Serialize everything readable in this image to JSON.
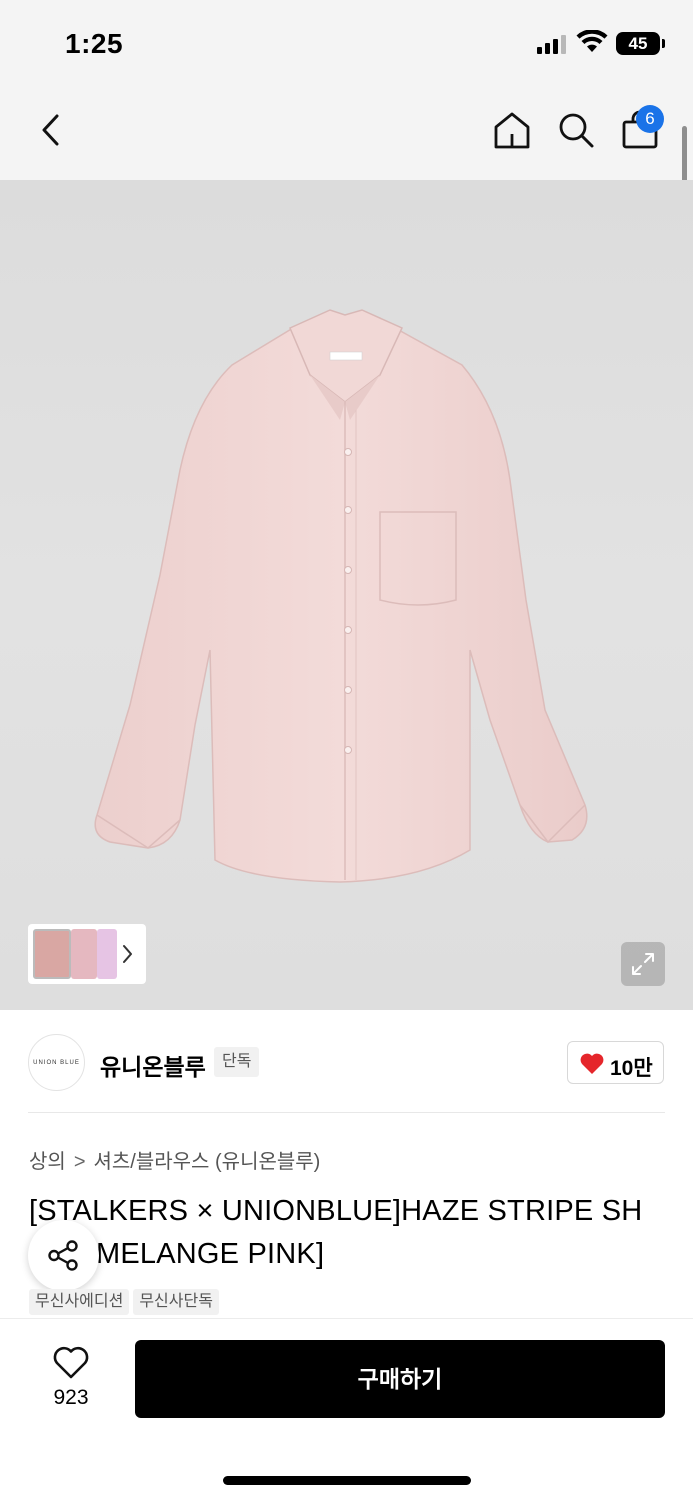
{
  "status_bar": {
    "time": "1:25",
    "battery": "45",
    "signal_icon": "cellular-signal-icon",
    "wifi_icon": "wifi-icon"
  },
  "nav": {
    "back_icon": "chevron-left-icon",
    "home_icon": "home-icon",
    "search_icon": "search-icon",
    "cart_icon": "shopping-bag-icon",
    "cart_count": "6"
  },
  "gallery": {
    "main_image": "pink-oxford-shirt-photo",
    "thumb_count": 3,
    "next_icon": "chevron-right-icon",
    "expand_icon": "expand-icon"
  },
  "brand": {
    "logo_text": "UNION BLUE",
    "name": "유니온블루",
    "badge": "단독",
    "like_count": "10만",
    "heart_icon": "heart-filled-icon",
    "heart_color": "#e5262b"
  },
  "breadcrumb": {
    "category": "상의",
    "separator": ">",
    "subcategory": "셔츠/블라우스 (유니온블루)"
  },
  "product": {
    "title_line1": "[STALKERS × UNIONBLUE]HAZE STRIPE SH",
    "title_line2": "MELANGE PINK]",
    "tags": [
      "무신사에디션",
      "무신사단독"
    ],
    "share_icon": "share-icon"
  },
  "bottom_bar": {
    "wish_icon": "heart-outline-icon",
    "wish_count": "923",
    "buy_label": "구매하기"
  },
  "colors": {
    "accent": "#1a73e8",
    "buy_button": "#000000",
    "shirt": "#f0d6d4"
  }
}
